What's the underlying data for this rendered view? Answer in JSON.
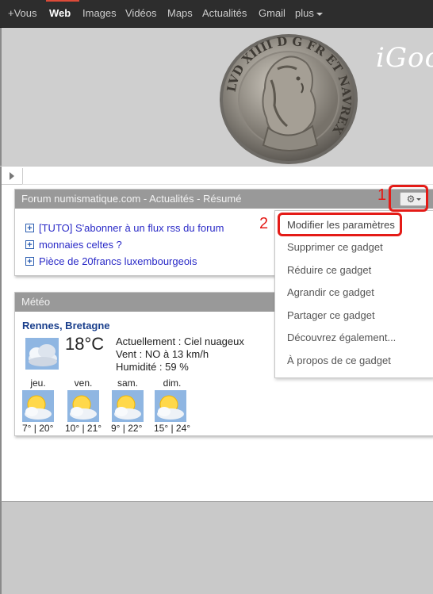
{
  "topnav": {
    "items": [
      {
        "label": "+Vous"
      },
      {
        "label": "Web"
      },
      {
        "label": "Images"
      },
      {
        "label": "Vidéos"
      },
      {
        "label": "Maps"
      },
      {
        "label": "Actualités"
      },
      {
        "label": "Gmail"
      },
      {
        "label": "plus"
      }
    ],
    "active": "Web"
  },
  "header": {
    "brand": "iGoo",
    "coin_legend": "LVD XIIII D G FR ET NAVREX"
  },
  "gadget_rss": {
    "title": "Forum numismatique.com - Actualités - Résumé",
    "settings_icon": "gear-icon",
    "items": [
      {
        "text": "[TUTO] S'abonner à un flux rss du forum"
      },
      {
        "text": "monnaies celtes ?"
      },
      {
        "text": "Pièce de 20francs luxembourgeois"
      }
    ]
  },
  "annotations": {
    "step1": "1",
    "step2": "2",
    "color": "#e41b17"
  },
  "menu": {
    "items": [
      {
        "label": "Modifier les paramètres"
      },
      {
        "label": "Supprimer ce gadget"
      },
      {
        "label": "Réduire ce gadget"
      },
      {
        "label": "Agrandir ce gadget"
      },
      {
        "label": "Partager ce gadget"
      },
      {
        "label": "Découvrez également..."
      },
      {
        "label": "À propos de ce gadget"
      }
    ]
  },
  "gadget_weather": {
    "title": "Météo",
    "city": "Rennes, Bretagne",
    "temperature": "18°C",
    "conditions": "Actuellement : Ciel nuageux",
    "wind": "Vent : NO à 13 km/h",
    "humidity": "Humidité : 59 %",
    "forecast": [
      {
        "day": "jeu.",
        "temps": "7° | 20°"
      },
      {
        "day": "ven.",
        "temps": "10° | 21°"
      },
      {
        "day": "sam.",
        "temps": "9° | 22°"
      },
      {
        "day": "dim.",
        "temps": "15° | 24°"
      }
    ]
  }
}
